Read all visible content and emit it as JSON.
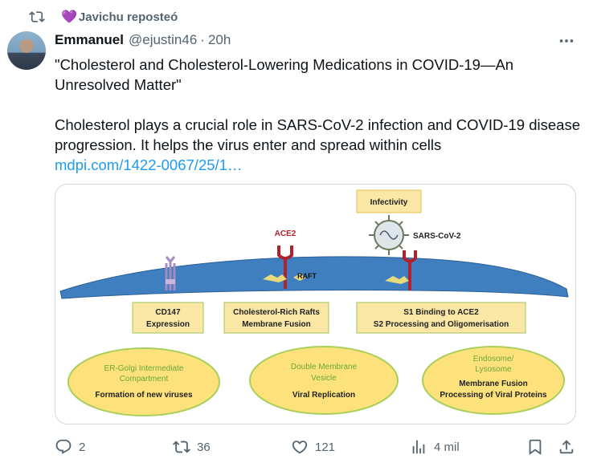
{
  "repost": {
    "label": "Javichu reposteó",
    "heart": "💜"
  },
  "author": {
    "name": "Emmanuel",
    "handle": "@ejustin46",
    "time": "20h"
  },
  "tweet": {
    "line1": "\"Cholesterol and Cholesterol-Lowering Medications in COVID-19—An Unresolved Matter\"",
    "line2": "Cholesterol plays a crucial role in SARS-CoV-2 infection and COVID-19 disease progression. It helps the virus enter and spread within cells",
    "link": "mdpi.com/1422-0067/25/1…"
  },
  "diagram": {
    "infectivity": "Infectivity",
    "ace2": "ACE2",
    "sars": "SARS-CoV-2",
    "raft": "RAFT",
    "box1_l1": "CD147",
    "box1_l2": "Expression",
    "box2_l1": "Cholesterol-Rich Rafts",
    "box2_l2": "Membrane Fusion",
    "box3_l1": "S1 Binding to ACE2",
    "box3_l2": "S2 Processing and Oligomerisation",
    "ell1_l1": "ER-Golgi Intermediate",
    "ell1_l2": "Compartment",
    "ell1_l3": "Formation of new viruses",
    "ell2_l1": "Double Membrane",
    "ell2_l2": "Vesicle",
    "ell2_l3": "Viral Replication",
    "ell3_l1": "Endosome/",
    "ell3_l2": "Lysosome",
    "ell3_l3": "Membrane Fusion",
    "ell3_l4": "Processing of Viral Proteins"
  },
  "actions": {
    "replies": "2",
    "reposts": "36",
    "likes": "121",
    "views": "4 mil"
  },
  "colors": {
    "accent": "#1d9bf0",
    "membrane": "#3f7fc0",
    "box": "#fbe7a5",
    "ellipse": "#fde27c",
    "ellipse_border": "#a8cf5a",
    "receptor": "#b0222f"
  }
}
